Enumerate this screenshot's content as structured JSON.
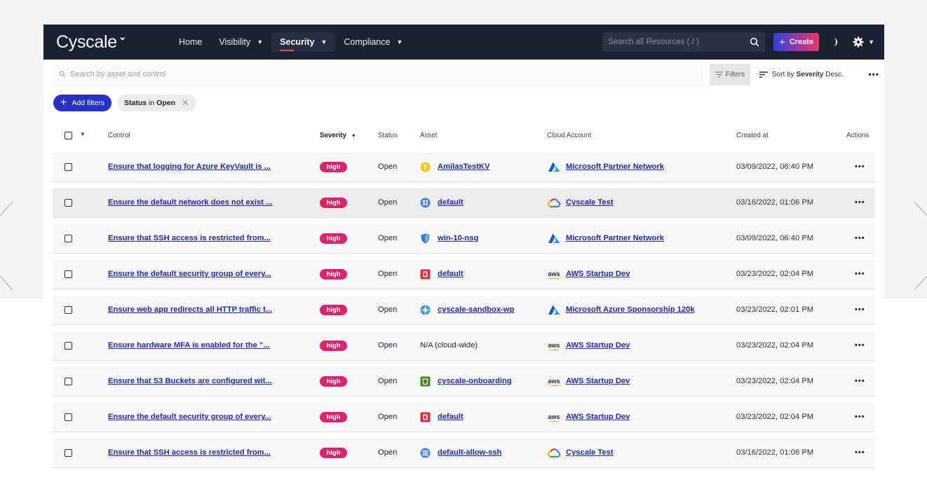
{
  "app": {
    "logo_text": "Cyscale"
  },
  "nav": {
    "items": [
      {
        "label": "Home",
        "has_dropdown": false
      },
      {
        "label": "Visibility",
        "has_dropdown": true
      },
      {
        "label": "Security",
        "has_dropdown": true,
        "active": true
      },
      {
        "label": "Compliance",
        "has_dropdown": true
      }
    ],
    "search_placeholder": "Search all Resources ( / )",
    "create_label": "Create"
  },
  "toolbar": {
    "asset_search_placeholder": "Search by asset and control",
    "filters_label": "Filters",
    "sort_prefix": "Sort by",
    "sort_field": "Severity",
    "sort_dir": "Desc."
  },
  "chips": {
    "add_filters_label": "Add filters",
    "status_key": "Status",
    "status_op": "in",
    "status_value": "Open"
  },
  "table": {
    "headers": {
      "control": "Control",
      "severity": "Severity",
      "status": "Status",
      "asset": "Asset",
      "cloud_account": "Cloud Account",
      "created_at": "Created at",
      "actions": "Actions"
    },
    "rows": [
      {
        "control": "Ensure that logging for Azure KeyVault is ...",
        "severity": "high",
        "status": "Open",
        "asset": "AmilasTestKV",
        "asset_link": true,
        "asset_icon": "key-vault-icon",
        "cloud": "Microsoft Partner Network",
        "cloud_icon": "azure-icon",
        "created": "03/09/2022, 06:40 PM",
        "actions": "•••"
      },
      {
        "control": "Ensure the default network does not exist ...",
        "severity": "high",
        "status": "Open",
        "asset": "default",
        "asset_link": true,
        "asset_icon": "vpc-network-icon",
        "cloud": "Cyscale Test",
        "cloud_icon": "gcp-icon",
        "created": "03/16/2022, 01:06 PM",
        "actions": "•••"
      },
      {
        "control": "Ensure that SSH access is restricted from...",
        "severity": "high",
        "status": "Open",
        "asset": "win-10-nsg",
        "asset_link": true,
        "asset_icon": "nsg-shield-icon",
        "cloud": "Microsoft Partner Network",
        "cloud_icon": "azure-icon",
        "created": "03/09/2022, 06:40 PM",
        "actions": "•••"
      },
      {
        "control": "Ensure the default security group of every...",
        "severity": "high",
        "status": "Open",
        "asset": "default",
        "asset_link": true,
        "asset_icon": "security-group-icon",
        "cloud": "AWS Startup Dev",
        "cloud_icon": "aws-icon",
        "created": "03/23/2022, 02:04 PM",
        "actions": "•••"
      },
      {
        "control": "Ensure web app redirects all HTTP traffic t...",
        "severity": "high",
        "status": "Open",
        "asset": "cyscale-sandbox-wp",
        "asset_link": true,
        "asset_icon": "web-app-icon",
        "cloud": "Microsoft Azure Sponsorship 120k",
        "cloud_icon": "azure-icon",
        "created": "03/23/2022, 02:01 PM",
        "actions": "•••"
      },
      {
        "control": "Ensure hardware MFA is enabled for the \"...",
        "severity": "high",
        "status": "Open",
        "asset": "N/A (cloud-wide)",
        "asset_link": false,
        "asset_icon": "",
        "cloud": "AWS Startup Dev",
        "cloud_icon": "aws-icon",
        "created": "03/23/2022, 02:04 PM",
        "actions": "•••"
      },
      {
        "control": "Ensure that S3 Buckets are configured wit...",
        "severity": "high",
        "status": "Open",
        "asset": "cyscale-onboarding",
        "asset_link": true,
        "asset_icon": "s3-bucket-icon",
        "cloud": "AWS Startup Dev",
        "cloud_icon": "aws-icon",
        "created": "03/23/2022, 02:04 PM",
        "actions": "•••"
      },
      {
        "control": "Ensure the default security group of every...",
        "severity": "high",
        "status": "Open",
        "asset": "default",
        "asset_link": true,
        "asset_icon": "security-group-icon",
        "cloud": "AWS Startup Dev",
        "cloud_icon": "aws-icon",
        "created": "03/23/2022, 02:04 PM",
        "actions": "•••"
      },
      {
        "control": "Ensure that SSH access is restricted from...",
        "severity": "high",
        "status": "Open",
        "asset": "default-allow-ssh",
        "asset_link": true,
        "asset_icon": "firewall-rule-icon",
        "cloud": "Cyscale Test",
        "cloud_icon": "gcp-icon",
        "created": "03/16/2022, 01:06 PM",
        "actions": "•••"
      }
    ]
  },
  "colors": {
    "nav_bg": "#1b2234",
    "link": "#1f29b8",
    "severity_high": "#e0216e",
    "add_filters_bg": "#2731c9"
  }
}
